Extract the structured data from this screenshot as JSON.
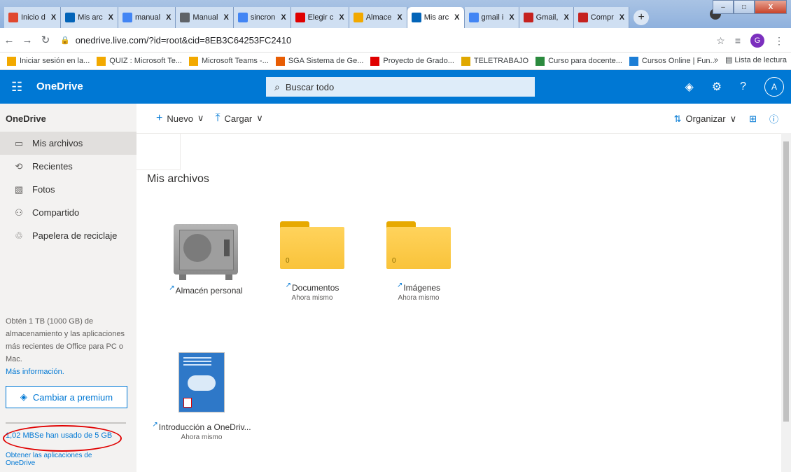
{
  "browser": {
    "tabs": [
      {
        "label": "Inicio d",
        "color": "#e0482f"
      },
      {
        "label": "Mis arc",
        "color": "#0364b8"
      },
      {
        "label": "manual",
        "color": "#4285f4"
      },
      {
        "label": "Manual",
        "color": "#5f6368"
      },
      {
        "label": "sincron",
        "color": "#4285f4"
      },
      {
        "label": "Elegir c",
        "color": "#e00000"
      },
      {
        "label": "Almace",
        "color": "#f2a900"
      },
      {
        "label": "Mis arc",
        "color": "#0364b8"
      },
      {
        "label": "gmail i",
        "color": "#4285f4"
      },
      {
        "label": "Gmail,",
        "color": "#c5221f"
      },
      {
        "label": "Compr",
        "color": "#c5221f"
      }
    ],
    "url": "onedrive.live.com/?id=root&cid=8EB3C64253FC2410",
    "profile_initial": "G",
    "bookmarks": [
      {
        "label": "Iniciar sesión en la...",
        "color": "#f2a900"
      },
      {
        "label": "QUIZ : Microsoft Te...",
        "color": "#f2a900"
      },
      {
        "label": "Microsoft Teams -...",
        "color": "#f2a900"
      },
      {
        "label": "SGA Sistema de Ge...",
        "color": "#e85d04"
      },
      {
        "label": "Proyecto de Grado...",
        "color": "#e00000"
      },
      {
        "label": "TELETRABAJO",
        "color": "#e0a800"
      },
      {
        "label": "Curso para docente...",
        "color": "#2b8a3e"
      },
      {
        "label": "Cursos Online | Fun...",
        "color": "#1c7ed6"
      }
    ],
    "bookmarks_overflow": "»",
    "reading_list": "Lista de lectura"
  },
  "header": {
    "brand": "OneDrive",
    "search_placeholder": "Buscar todo",
    "account_initial": "A"
  },
  "sidebar": {
    "title": "OneDrive",
    "items": [
      {
        "label": "Mis archivos",
        "icon": "folder-icon"
      },
      {
        "label": "Recientes",
        "icon": "clock-icon"
      },
      {
        "label": "Fotos",
        "icon": "photo-icon"
      },
      {
        "label": "Compartido",
        "icon": "people-icon"
      },
      {
        "label": "Papelera de reciclaje",
        "icon": "trash-icon"
      }
    ],
    "promo": "Obtén 1 TB (1000 GB) de almacenamiento y las aplicaciones más recientes de Office para PC o Mac.",
    "promo_link": "Más información.",
    "premium_label": "Cambiar a premium",
    "storage_text": "1,02 MBSe han usado de 5 GB",
    "get_apps": "Obtener las aplicaciones de OneDrive"
  },
  "commandbar": {
    "new_label": "Nuevo",
    "upload_label": "Cargar",
    "organize_label": "Organizar"
  },
  "main": {
    "title": "Mis archivos",
    "items": [
      {
        "name": "Almacén personal",
        "sub": "",
        "type": "vault"
      },
      {
        "name": "Documentos",
        "sub": "Ahora mismo",
        "type": "folder",
        "count": "0"
      },
      {
        "name": "Imágenes",
        "sub": "Ahora mismo",
        "type": "folder",
        "count": "0"
      },
      {
        "name": "Introducción a OneDriv...",
        "sub": "Ahora mismo",
        "type": "document"
      }
    ]
  }
}
